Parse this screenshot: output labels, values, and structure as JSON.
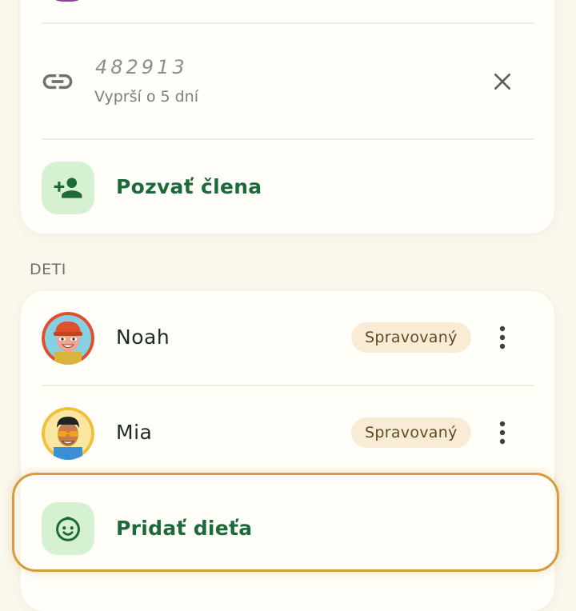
{
  "invite": {
    "code": "482913",
    "expiry": "Vyprší o 5 dní",
    "link_icon": "link-icon",
    "close_icon": "close-icon"
  },
  "invite_member": {
    "label": "Pozvať člena",
    "icon": "person-add-icon"
  },
  "children_section": {
    "title": "DETI",
    "children": [
      {
        "name": "Noah",
        "badge": "Spravovaný",
        "more_icon": "more-vert-icon"
      },
      {
        "name": "Mia",
        "badge": "Spravovaný",
        "more_icon": "more-vert-icon"
      }
    ]
  },
  "add_child": {
    "label": "Pridať dieťa",
    "icon": "child-face-icon"
  },
  "colors": {
    "background": "#faf7ec",
    "card": "#fffef9",
    "accent_green": "#1c6a3a",
    "tile_green": "#d6f1d2",
    "badge_bg": "#f8ecd6",
    "highlight": "#d59b3e"
  }
}
